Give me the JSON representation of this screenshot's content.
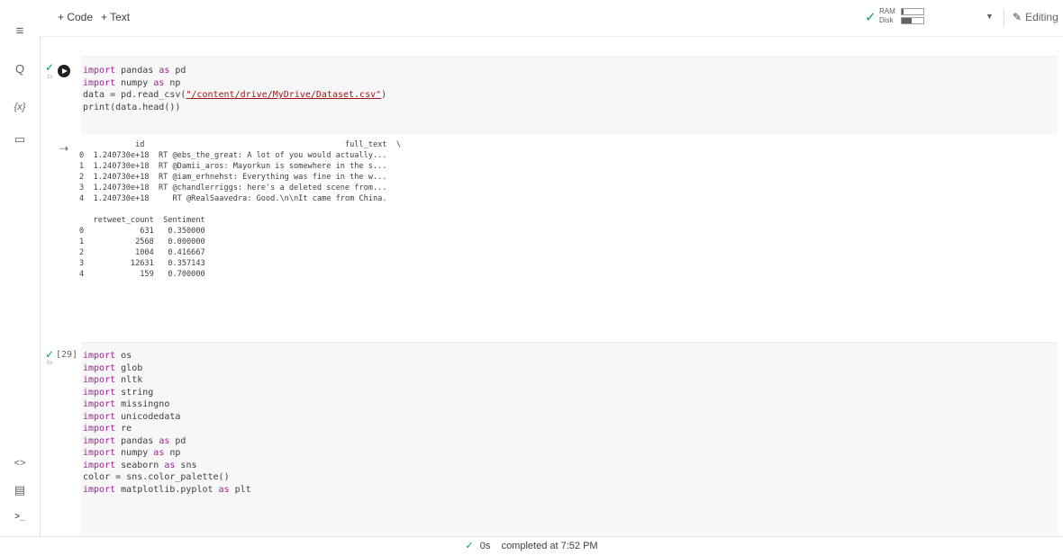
{
  "toolbar": {
    "add_code": "+ Code",
    "add_text": "+ Text",
    "ram_label": "RAM",
    "disk_label": "Disk",
    "ram_usage_fraction": 0.08,
    "disk_usage_fraction": 0.45,
    "editing_label": "Editing"
  },
  "sidebar": {
    "menu_icon": "≡",
    "search_icon": "Q",
    "variables_icon": "{x}",
    "files_icon": "▭",
    "code_snippets_icon": "<>",
    "command_palette_icon": "▤",
    "terminal_icon": ">_"
  },
  "cell1": {
    "status": "✓",
    "time": "1s",
    "code": [
      "import pandas as pd",
      "import numpy as np",
      "data = pd.read_csv(\"/content/drive/MyDrive/Dataset.csv\")",
      "print(data.head())"
    ],
    "output": [
      "            id                                           full_text  \\",
      "0  1.240730e+18  RT @ebs_the_great: A lot of you would actually...",
      "1  1.240730e+18  RT @Damii_aros: Mayorkun is somewhere in the s...",
      "2  1.240730e+18  RT @iam_erhnehst: Everything was fine in the w...",
      "3  1.240730e+18  RT @chandlerriggs: here's a deleted scene from...",
      "4  1.240730e+18     RT @RealSaavedra: Good.\\n\\nIt came from China.",
      "",
      "   retweet_count  Sentiment",
      "0            631   0.350000",
      "1           2568   0.000000",
      "2           1004   0.416667",
      "3          12631   0.357143",
      "4            159   0.700000"
    ]
  },
  "cell2": {
    "status": "✓",
    "time": "0s",
    "exec_count": "[29]",
    "code": [
      "import os",
      "import glob",
      "import nltk",
      "import string",
      "import missingno",
      "import unicodedata",
      "import re",
      "import pandas as pd",
      "import numpy as np",
      "import seaborn as sns",
      "color = sns.color_palette()",
      "import matplotlib.pyplot as plt"
    ]
  },
  "statusbar": {
    "check": "✓",
    "duration": "0s",
    "message": "completed at 7:52 PM"
  },
  "colors": {
    "success": "#0f9d58",
    "keyword": "#9b2393",
    "string": "#a31515",
    "cell_background": "#f7f7f7"
  }
}
